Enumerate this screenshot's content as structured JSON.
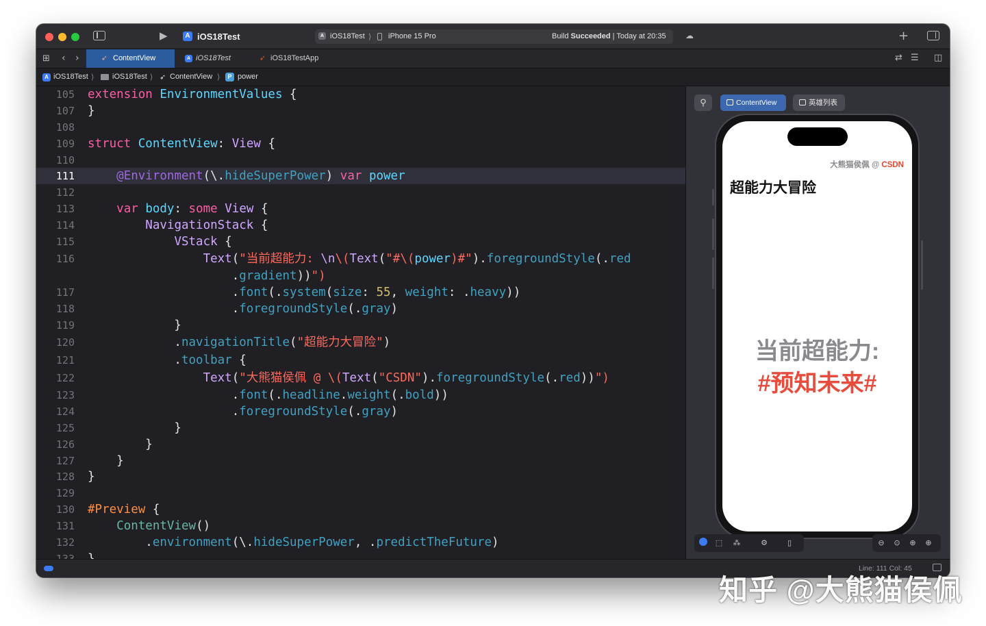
{
  "titlebar": {
    "project": "iOS18Test",
    "scheme": "iOS18Test",
    "device": "iPhone 15 Pro",
    "status_prefix": "Build",
    "status_bold": "Succeeded",
    "status_suffix": " | Today at 20:35"
  },
  "tabs": [
    {
      "label": "ContentView",
      "active": true,
      "icon": "swift-icon"
    },
    {
      "label": "iOS18Test",
      "active": false,
      "icon": "project-icon"
    },
    {
      "label": "iOS18TestApp",
      "active": false,
      "icon": "swift-icon"
    }
  ],
  "breadcrumb": [
    "iOS18Test",
    "iOS18Test",
    "ContentView",
    "power"
  ],
  "code_lines": [
    {
      "n": "105",
      "text": "extension EnvironmentValues {"
    },
    {
      "n": "107",
      "text": "}"
    },
    {
      "n": "108",
      "text": ""
    },
    {
      "n": "109",
      "text": "struct ContentView: View {"
    },
    {
      "n": "110",
      "text": ""
    },
    {
      "n": "111",
      "text": "    @Environment(\\.hideSuperPower) var power",
      "current": true
    },
    {
      "n": "112",
      "text": ""
    },
    {
      "n": "113",
      "text": "    var body: some View {"
    },
    {
      "n": "114",
      "text": "        NavigationStack {"
    },
    {
      "n": "115",
      "text": "            VStack {"
    },
    {
      "n": "116",
      "text": "                Text(\"当前超能力: \\n\\(Text(\"#\\(power)#\").foregroundStyle(.red"
    },
    {
      "n": "",
      "text": "                    .gradient))\")"
    },
    {
      "n": "117",
      "text": "                    .font(.system(size: 55, weight: .heavy))"
    },
    {
      "n": "118",
      "text": "                    .foregroundStyle(.gray)"
    },
    {
      "n": "119",
      "text": "            }"
    },
    {
      "n": "120",
      "text": "            .navigationTitle(\"超能力大冒险\")"
    },
    {
      "n": "121",
      "text": "            .toolbar {"
    },
    {
      "n": "122",
      "text": "                Text(\"大熊猫侯佩 @ \\(Text(\"CSDN\").foregroundStyle(.red))\")"
    },
    {
      "n": "123",
      "text": "                    .font(.headline.weight(.bold))"
    },
    {
      "n": "124",
      "text": "                    .foregroundStyle(.gray)"
    },
    {
      "n": "125",
      "text": "            }"
    },
    {
      "n": "126",
      "text": "        }"
    },
    {
      "n": "127",
      "text": "    }"
    },
    {
      "n": "128",
      "text": "}"
    },
    {
      "n": "129",
      "text": ""
    },
    {
      "n": "130",
      "text": "#Preview {"
    },
    {
      "n": "131",
      "text": "    ContentView()"
    },
    {
      "n": "132",
      "text": "        .environment(\\.hideSuperPower, .predictTheFuture)"
    },
    {
      "n": "133",
      "text": "}"
    }
  ],
  "preview": {
    "tabs": [
      "ContentView",
      "英雄列表"
    ],
    "toolbar_author": "大熊猫侯佩 @ ",
    "toolbar_site": "CSDN",
    "nav_title": "超能力大冒险",
    "power_label": "当前超能力:",
    "power_value": "#预知未来#"
  },
  "statusbar": {
    "cursor": "Line: 111  Col: 45"
  },
  "watermark": "知乎 @大熊猫侯佩",
  "colors": {
    "accent": "#3d7bf2",
    "red": "#e74c3c",
    "active_tab": "#2b5c9e"
  }
}
